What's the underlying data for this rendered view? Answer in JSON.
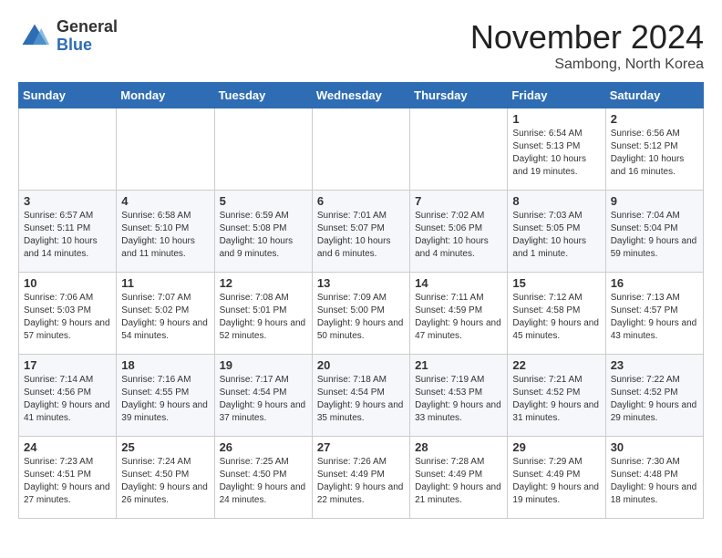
{
  "logo": {
    "general": "General",
    "blue": "Blue"
  },
  "title": "November 2024",
  "location": "Sambong, North Korea",
  "weekdays": [
    "Sunday",
    "Monday",
    "Tuesday",
    "Wednesday",
    "Thursday",
    "Friday",
    "Saturday"
  ],
  "weeks": [
    [
      {
        "day": "",
        "info": ""
      },
      {
        "day": "",
        "info": ""
      },
      {
        "day": "",
        "info": ""
      },
      {
        "day": "",
        "info": ""
      },
      {
        "day": "",
        "info": ""
      },
      {
        "day": "1",
        "info": "Sunrise: 6:54 AM\nSunset: 5:13 PM\nDaylight: 10 hours and 19 minutes."
      },
      {
        "day": "2",
        "info": "Sunrise: 6:56 AM\nSunset: 5:12 PM\nDaylight: 10 hours and 16 minutes."
      }
    ],
    [
      {
        "day": "3",
        "info": "Sunrise: 6:57 AM\nSunset: 5:11 PM\nDaylight: 10 hours and 14 minutes."
      },
      {
        "day": "4",
        "info": "Sunrise: 6:58 AM\nSunset: 5:10 PM\nDaylight: 10 hours and 11 minutes."
      },
      {
        "day": "5",
        "info": "Sunrise: 6:59 AM\nSunset: 5:08 PM\nDaylight: 10 hours and 9 minutes."
      },
      {
        "day": "6",
        "info": "Sunrise: 7:01 AM\nSunset: 5:07 PM\nDaylight: 10 hours and 6 minutes."
      },
      {
        "day": "7",
        "info": "Sunrise: 7:02 AM\nSunset: 5:06 PM\nDaylight: 10 hours and 4 minutes."
      },
      {
        "day": "8",
        "info": "Sunrise: 7:03 AM\nSunset: 5:05 PM\nDaylight: 10 hours and 1 minute."
      },
      {
        "day": "9",
        "info": "Sunrise: 7:04 AM\nSunset: 5:04 PM\nDaylight: 9 hours and 59 minutes."
      }
    ],
    [
      {
        "day": "10",
        "info": "Sunrise: 7:06 AM\nSunset: 5:03 PM\nDaylight: 9 hours and 57 minutes."
      },
      {
        "day": "11",
        "info": "Sunrise: 7:07 AM\nSunset: 5:02 PM\nDaylight: 9 hours and 54 minutes."
      },
      {
        "day": "12",
        "info": "Sunrise: 7:08 AM\nSunset: 5:01 PM\nDaylight: 9 hours and 52 minutes."
      },
      {
        "day": "13",
        "info": "Sunrise: 7:09 AM\nSunset: 5:00 PM\nDaylight: 9 hours and 50 minutes."
      },
      {
        "day": "14",
        "info": "Sunrise: 7:11 AM\nSunset: 4:59 PM\nDaylight: 9 hours and 47 minutes."
      },
      {
        "day": "15",
        "info": "Sunrise: 7:12 AM\nSunset: 4:58 PM\nDaylight: 9 hours and 45 minutes."
      },
      {
        "day": "16",
        "info": "Sunrise: 7:13 AM\nSunset: 4:57 PM\nDaylight: 9 hours and 43 minutes."
      }
    ],
    [
      {
        "day": "17",
        "info": "Sunrise: 7:14 AM\nSunset: 4:56 PM\nDaylight: 9 hours and 41 minutes."
      },
      {
        "day": "18",
        "info": "Sunrise: 7:16 AM\nSunset: 4:55 PM\nDaylight: 9 hours and 39 minutes."
      },
      {
        "day": "19",
        "info": "Sunrise: 7:17 AM\nSunset: 4:54 PM\nDaylight: 9 hours and 37 minutes."
      },
      {
        "day": "20",
        "info": "Sunrise: 7:18 AM\nSunset: 4:54 PM\nDaylight: 9 hours and 35 minutes."
      },
      {
        "day": "21",
        "info": "Sunrise: 7:19 AM\nSunset: 4:53 PM\nDaylight: 9 hours and 33 minutes."
      },
      {
        "day": "22",
        "info": "Sunrise: 7:21 AM\nSunset: 4:52 PM\nDaylight: 9 hours and 31 minutes."
      },
      {
        "day": "23",
        "info": "Sunrise: 7:22 AM\nSunset: 4:52 PM\nDaylight: 9 hours and 29 minutes."
      }
    ],
    [
      {
        "day": "24",
        "info": "Sunrise: 7:23 AM\nSunset: 4:51 PM\nDaylight: 9 hours and 27 minutes."
      },
      {
        "day": "25",
        "info": "Sunrise: 7:24 AM\nSunset: 4:50 PM\nDaylight: 9 hours and 26 minutes."
      },
      {
        "day": "26",
        "info": "Sunrise: 7:25 AM\nSunset: 4:50 PM\nDaylight: 9 hours and 24 minutes."
      },
      {
        "day": "27",
        "info": "Sunrise: 7:26 AM\nSunset: 4:49 PM\nDaylight: 9 hours and 22 minutes."
      },
      {
        "day": "28",
        "info": "Sunrise: 7:28 AM\nSunset: 4:49 PM\nDaylight: 9 hours and 21 minutes."
      },
      {
        "day": "29",
        "info": "Sunrise: 7:29 AM\nSunset: 4:49 PM\nDaylight: 9 hours and 19 minutes."
      },
      {
        "day": "30",
        "info": "Sunrise: 7:30 AM\nSunset: 4:48 PM\nDaylight: 9 hours and 18 minutes."
      }
    ]
  ]
}
